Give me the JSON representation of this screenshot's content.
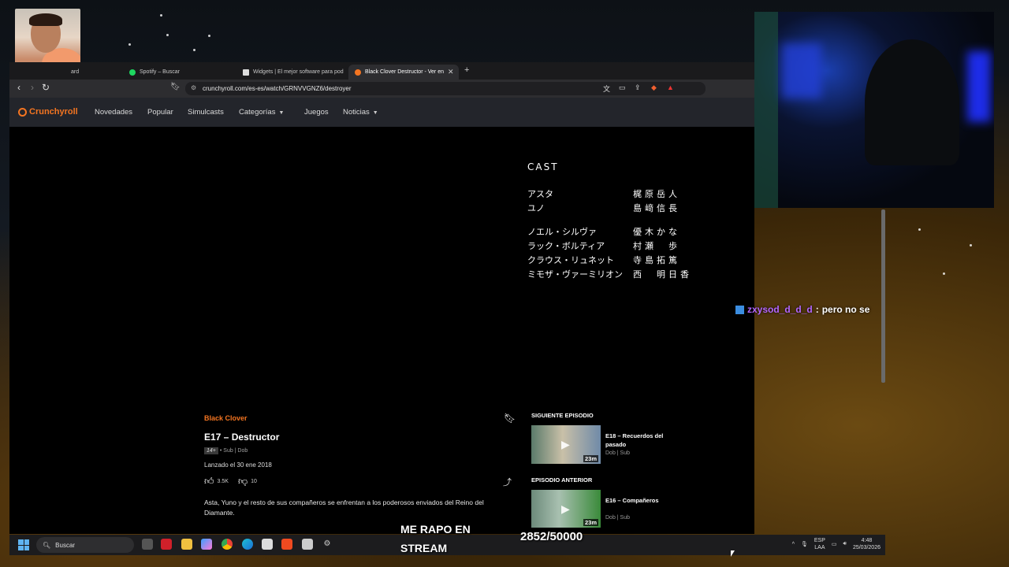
{
  "browser": {
    "tabs": [
      {
        "label": "ard"
      },
      {
        "label": "Spotify – Buscar"
      },
      {
        "label": "Widgets | El mejor software para pod"
      },
      {
        "label": "Black Clover Destructor - Ver en"
      }
    ],
    "url": "crunchyroll.com/es-es/watch/GRNVVGNZ6/destroyer"
  },
  "crunchyroll": {
    "logo": "Crunchyroll",
    "nav": [
      "Novedades",
      "Popular",
      "Simulcasts",
      "Categorías",
      "Juegos",
      "Noticias"
    ]
  },
  "credits": {
    "title": "CAST",
    "group1": [
      {
        "role": "アスタ",
        "name": "梶原岳人"
      },
      {
        "role": "ユノ",
        "name": "島﨑信長"
      }
    ],
    "group2": [
      {
        "role": "ノエル・シルヴァ",
        "name": "優木かな"
      },
      {
        "role": "ラック・ボルティア",
        "name": "村瀬　歩"
      },
      {
        "role": "クラウス・リュネット",
        "name": "寺島拓篤"
      },
      {
        "role": "ミモザ・ヴァーミリオン",
        "name": "西　明日香"
      }
    ]
  },
  "chat": {
    "user": "zxysod_d_d_d",
    "sep": ":",
    "message": "pero no se"
  },
  "episode": {
    "series": "Black Clover",
    "title": "E17 – Destructor",
    "age_rating": "14+",
    "audio": "• Sub | Dob",
    "release": "Lanzado el 30 ene 2018",
    "likes": "3.5K",
    "dislikes": "10",
    "description": "Asta, Yuno y el resto de sus compañeros se enfrentan a los poderosos enviados del Reino del Diamante."
  },
  "next": {
    "heading": "SIGUIENTE EPISODIO",
    "title": "E18 – Recuerdos del pasado",
    "meta": "Dob | Sub",
    "duration": "23m"
  },
  "prev": {
    "heading": "EPISODIO ANTERIOR",
    "title": "E16 – Compañeros",
    "meta": "Dob | Sub",
    "duration": "23m"
  },
  "overlay": {
    "stream_line1": "ME RAPO EN",
    "stream_line2": "STREAM",
    "counter": "2852/50000"
  },
  "taskbar": {
    "search_placeholder": "Buscar",
    "lang1": "ESP",
    "lang2": "LAA",
    "time": "4:48",
    "date": "25/03/2026"
  }
}
